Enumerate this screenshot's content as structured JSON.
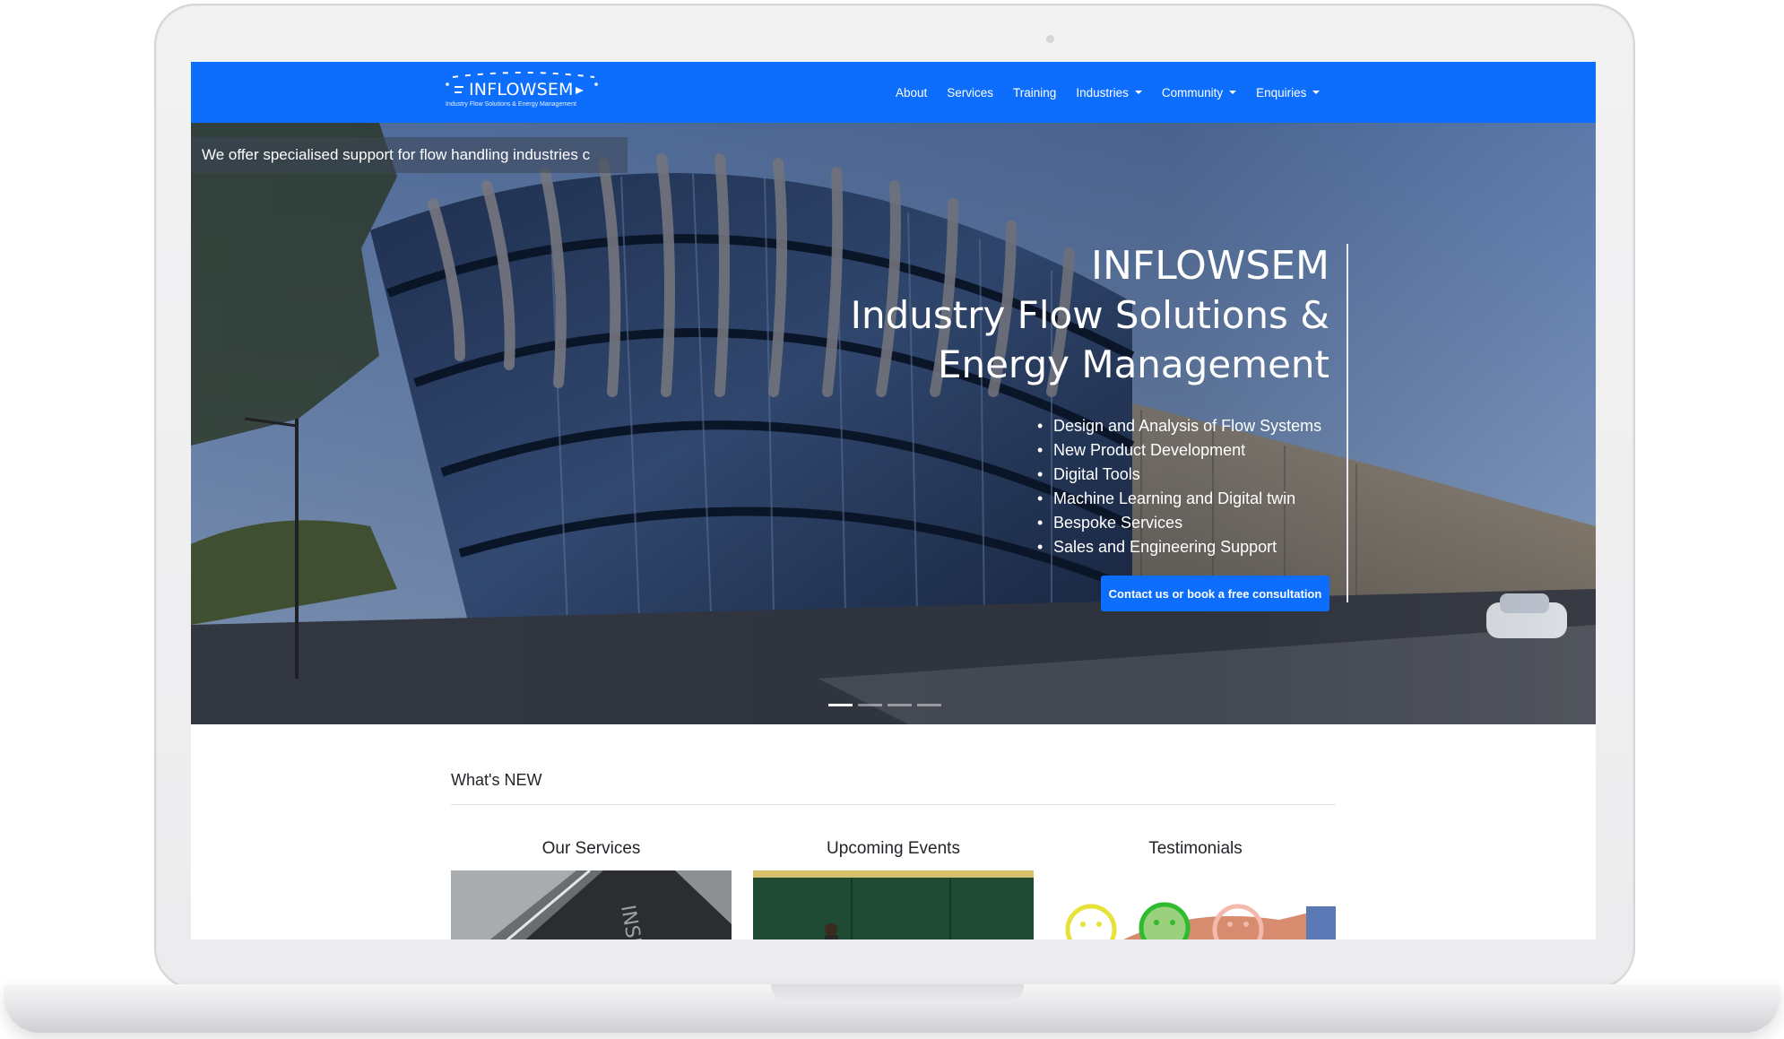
{
  "navbar": {
    "logo_text": "INFLOWSEM",
    "logo_tagline": "Industry Flow Solutions & Energy Management",
    "links": [
      {
        "label": "About",
        "dropdown": false
      },
      {
        "label": "Services",
        "dropdown": false
      },
      {
        "label": "Training",
        "dropdown": false
      },
      {
        "label": "Industries",
        "dropdown": true
      },
      {
        "label": "Community",
        "dropdown": true
      },
      {
        "label": "Enquiries",
        "dropdown": true
      }
    ]
  },
  "hero": {
    "ticker": "We offer specialised support for flow handling industries c",
    "title_line1": "INFLOWSEM",
    "title_line2": "Industry Flow Solutions &",
    "title_line3": "Energy Management",
    "bullets": [
      "Design and Analysis of Flow Systems",
      "New Product Development",
      "Digital Tools",
      "Machine Learning and Digital twin",
      "Bespoke Services",
      "Sales and Engineering Support"
    ],
    "cta_label": "Contact us or book a free consultation",
    "active_slide": 1,
    "slide_count": 4
  },
  "whats_new": {
    "heading": "What's NEW",
    "columns": [
      {
        "title": "Our Services"
      },
      {
        "title": "Upcoming Events"
      },
      {
        "title": "Testimonials"
      }
    ]
  },
  "colors": {
    "brand_blue": "#0d6efd",
    "text_dark": "#212529"
  }
}
